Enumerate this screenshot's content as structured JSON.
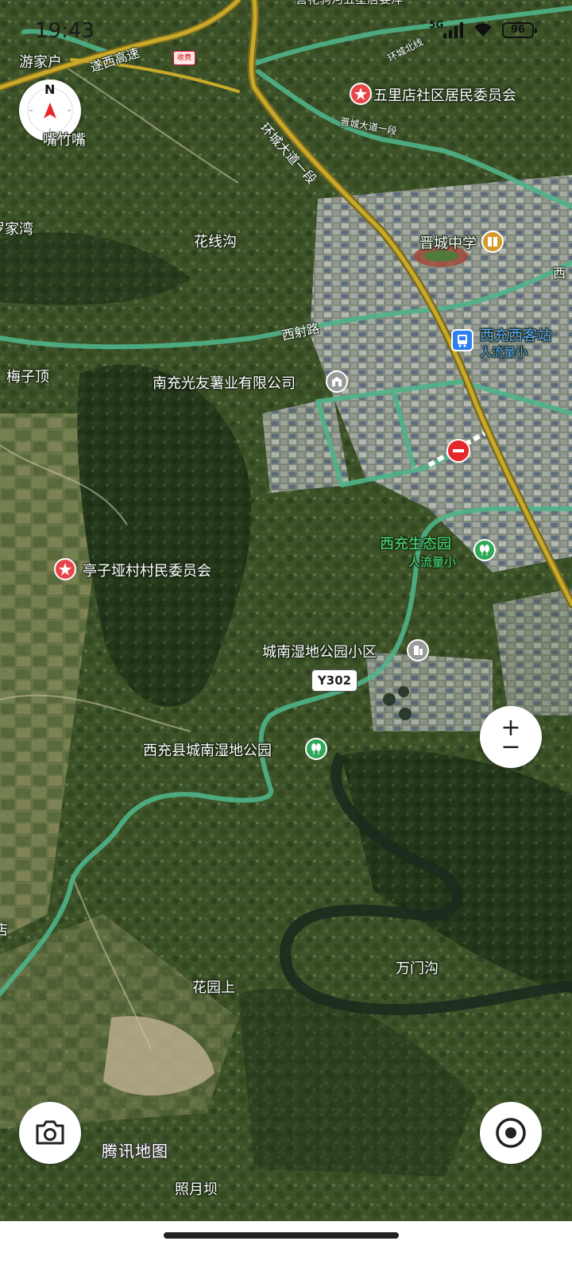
{
  "status_bar": {
    "time": "19:43",
    "network": "5G",
    "battery": "96"
  },
  "compass": {
    "north_label": "N"
  },
  "map_labels": {
    "top_cut": "营花驹河五星居委洋",
    "you_jia_hu": "游家户",
    "sui_xi": "遂西高速",
    "toll": "收费",
    "huan_cheng_bei": "环城北线",
    "wu_li_dian": "五里店社区居民委员会",
    "jin_cheng_da_dao": "晋城大道一段",
    "huan_cheng_da_dao": "环城大道一段",
    "zui_zui": "嘴竹嘴",
    "jia_wan": "罗家湾",
    "hua_xian_gou": "花线沟",
    "jin_cheng_zhong_xue": "晋城中学",
    "xi_she_lu": "西射路",
    "xi_chong_station": "西充西客站",
    "crowd_small_1": "人流量小",
    "xi_edge": "西",
    "mei_zi_ding": "梅子顶",
    "nan_chong_company": "南充光友薯业有限公司",
    "xi_chong_eco_park": "西充生态园",
    "crowd_small_2": "人流量小",
    "ting_zi_ya": "亭子垭村村民委员会",
    "cheng_nan_community": "城南湿地公园小区",
    "route_y302": "Y302",
    "cheng_nan_park": "西充县城南湿地公园",
    "jie_edge": "店",
    "wan_men_gou": "万门沟",
    "hua_yuan_shang": "花园上",
    "brand": "腾讯地图",
    "zhao_yue_ba": "照月坝"
  },
  "controls": {
    "zoom_in": "+",
    "zoom_out": "−"
  },
  "icons": {
    "camera": "camera-icon",
    "locate": "locate-icon",
    "compass": "compass-icon"
  }
}
